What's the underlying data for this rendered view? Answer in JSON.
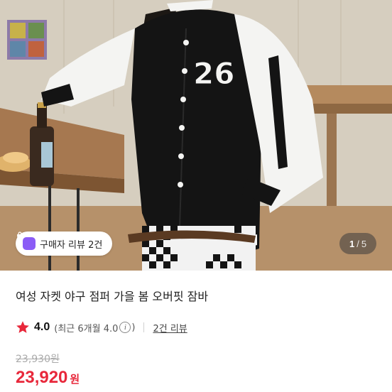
{
  "product_image": {
    "alt": "varsity jacket photo",
    "jacket_number": "26"
  },
  "review_chip": {
    "label": "구매자 리뷰 2건",
    "icon": "review-bag-icon",
    "icon_color": "#8b5cf6"
  },
  "pager": {
    "current": "1",
    "separator": "/",
    "total": "5"
  },
  "product": {
    "title": "여성 자켓 야구 점퍼 가을 봄 오버핏 잠바"
  },
  "rating": {
    "icon": "star-icon",
    "star_color": "#e8283b",
    "score": "4.0",
    "recent_prefix": "(최근 6개월 4.0",
    "info_icon_glyph": "i",
    "recent_suffix": ")",
    "review_link": "2건 리뷰"
  },
  "price": {
    "original": "23,930원",
    "sale_number": "23,920",
    "sale_unit": "원",
    "sale_color": "#e8283b"
  }
}
